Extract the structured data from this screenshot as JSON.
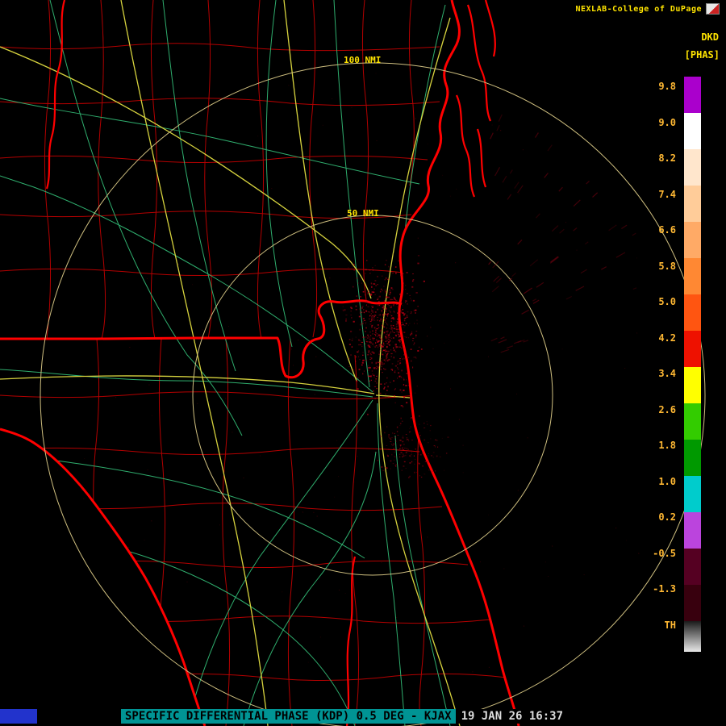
{
  "header": {
    "brand": "NEXLAB-College of DuPage",
    "product_code": "DKD",
    "units_label": "[PHAS]"
  },
  "colorbar": {
    "ticks": [
      "9.8",
      "9.0",
      "8.2",
      "7.4",
      "6.6",
      "5.8",
      "5.0",
      "4.2",
      "3.4",
      "2.6",
      "1.8",
      "1.0",
      "0.2",
      "-0.5",
      "-1.3",
      "TH"
    ],
    "segments": [
      "#aa00cc",
      "#ffffff",
      "#ffe6cc",
      "#ffcc99",
      "#ffaa66",
      "#ff8833",
      "#ff5511",
      "#ee1100",
      "#ffff00",
      "#33cc00",
      "#009900",
      "#00cccc",
      "#bb44dd",
      "#550022",
      "#38000e",
      "gray-gradient"
    ]
  },
  "map": {
    "range_rings": [
      {
        "label": "100 NMI",
        "radius_px": 412
      },
      {
        "label": "50 NMI",
        "radius_px": 223
      }
    ],
    "colors": {
      "county": "#b40000",
      "state": "#ff0000",
      "road": "#2fae6e",
      "highway": "#d6d23e",
      "ring": "#d0c080",
      "echo": "#c00016"
    }
  },
  "ui_colors": {
    "brand_yellow": "#ffe400",
    "tick_orange": "#ffb833",
    "status_teal": "#009494",
    "corner_blue": "#2233cc"
  },
  "status_bar": {
    "product_text": "SPECIFIC DIFFERENTIAL PHASE (KDP) 0.5 DEG - KJAX",
    "timestamp": "19 JAN 26 16:37"
  }
}
